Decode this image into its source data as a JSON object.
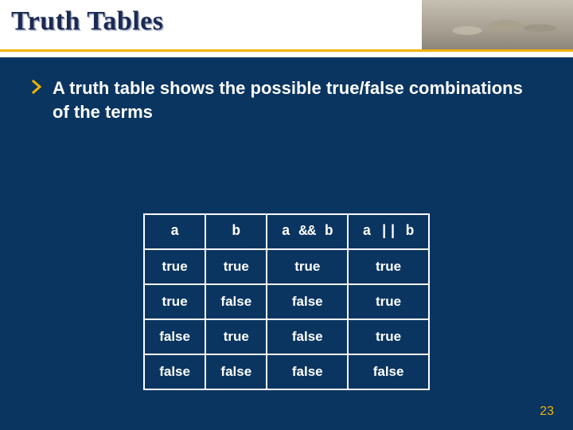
{
  "colors": {
    "background": "#0a3560",
    "rule": "#f2b201",
    "title": "#1b2a52",
    "page_number": "#f2b201",
    "table_border": "#ffffff"
  },
  "slide": {
    "title": "Truth Tables",
    "bullet_text": "A truth table shows the possible true/false combinations of the terms",
    "page_number": "23"
  },
  "truth_table": {
    "headers": [
      "a",
      "b",
      "a && b",
      "a || b"
    ],
    "rows": [
      [
        "true",
        "true",
        "true",
        "true"
      ],
      [
        "true",
        "false",
        "false",
        "true"
      ],
      [
        "false",
        "true",
        "false",
        "true"
      ],
      [
        "false",
        "false",
        "false",
        "false"
      ]
    ]
  }
}
